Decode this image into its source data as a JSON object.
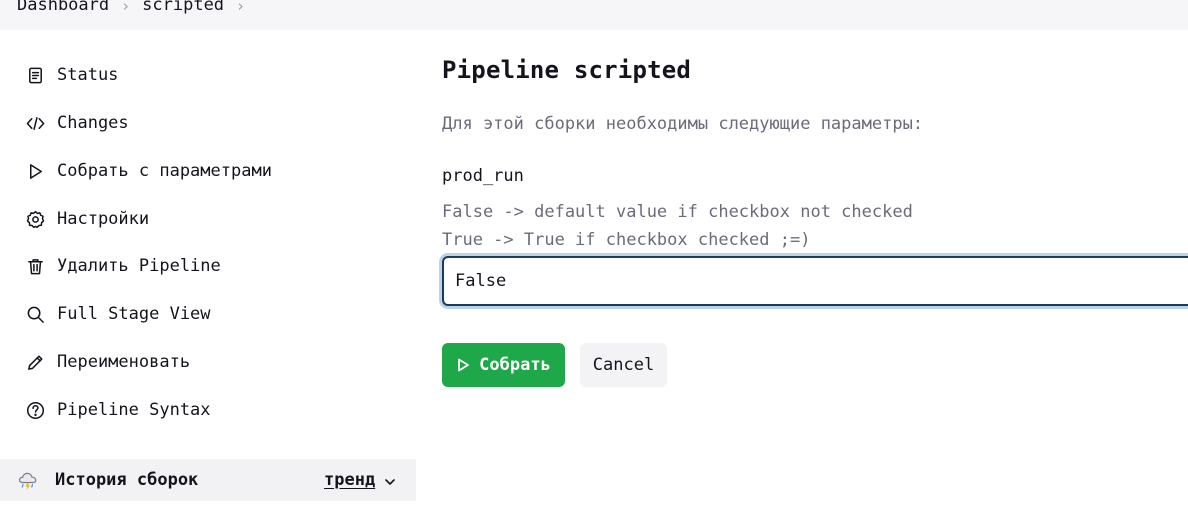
{
  "breadcrumb": {
    "items": [
      "Dashboard",
      "scripted"
    ],
    "separator": "›"
  },
  "sidebar": {
    "items": [
      {
        "label": "Status",
        "icon": "document-icon"
      },
      {
        "label": "Changes",
        "icon": "code-icon"
      },
      {
        "label": "Собрать с параметрами",
        "icon": "play-icon"
      },
      {
        "label": "Настройки",
        "icon": "gear-icon"
      },
      {
        "label": "Удалить Pipeline",
        "icon": "trash-icon"
      },
      {
        "label": "Full Stage View",
        "icon": "search-icon"
      },
      {
        "label": "Переименовать",
        "icon": "pencil-icon"
      },
      {
        "label": "Pipeline Syntax",
        "icon": "help-icon"
      }
    ]
  },
  "history": {
    "title": "История сборок",
    "trend_label": "тренд",
    "icon": "weather-storm-icon"
  },
  "main": {
    "title": "Pipeline scripted",
    "intro": "Для этой сборки необходимы следующие параметры:",
    "param": {
      "name": "prod_run",
      "description_lines": [
        "False -> default value if checkbox not checked",
        "True -> True if checkbox checked ;=)"
      ],
      "value": "False"
    },
    "build_label": "Собрать",
    "cancel_label": "Cancel"
  },
  "colors": {
    "accent_green": "#1ea84a",
    "input_border": "#1b3a5c",
    "focus_ring": "#b9d3ea",
    "muted_text": "#6b6b7b"
  }
}
